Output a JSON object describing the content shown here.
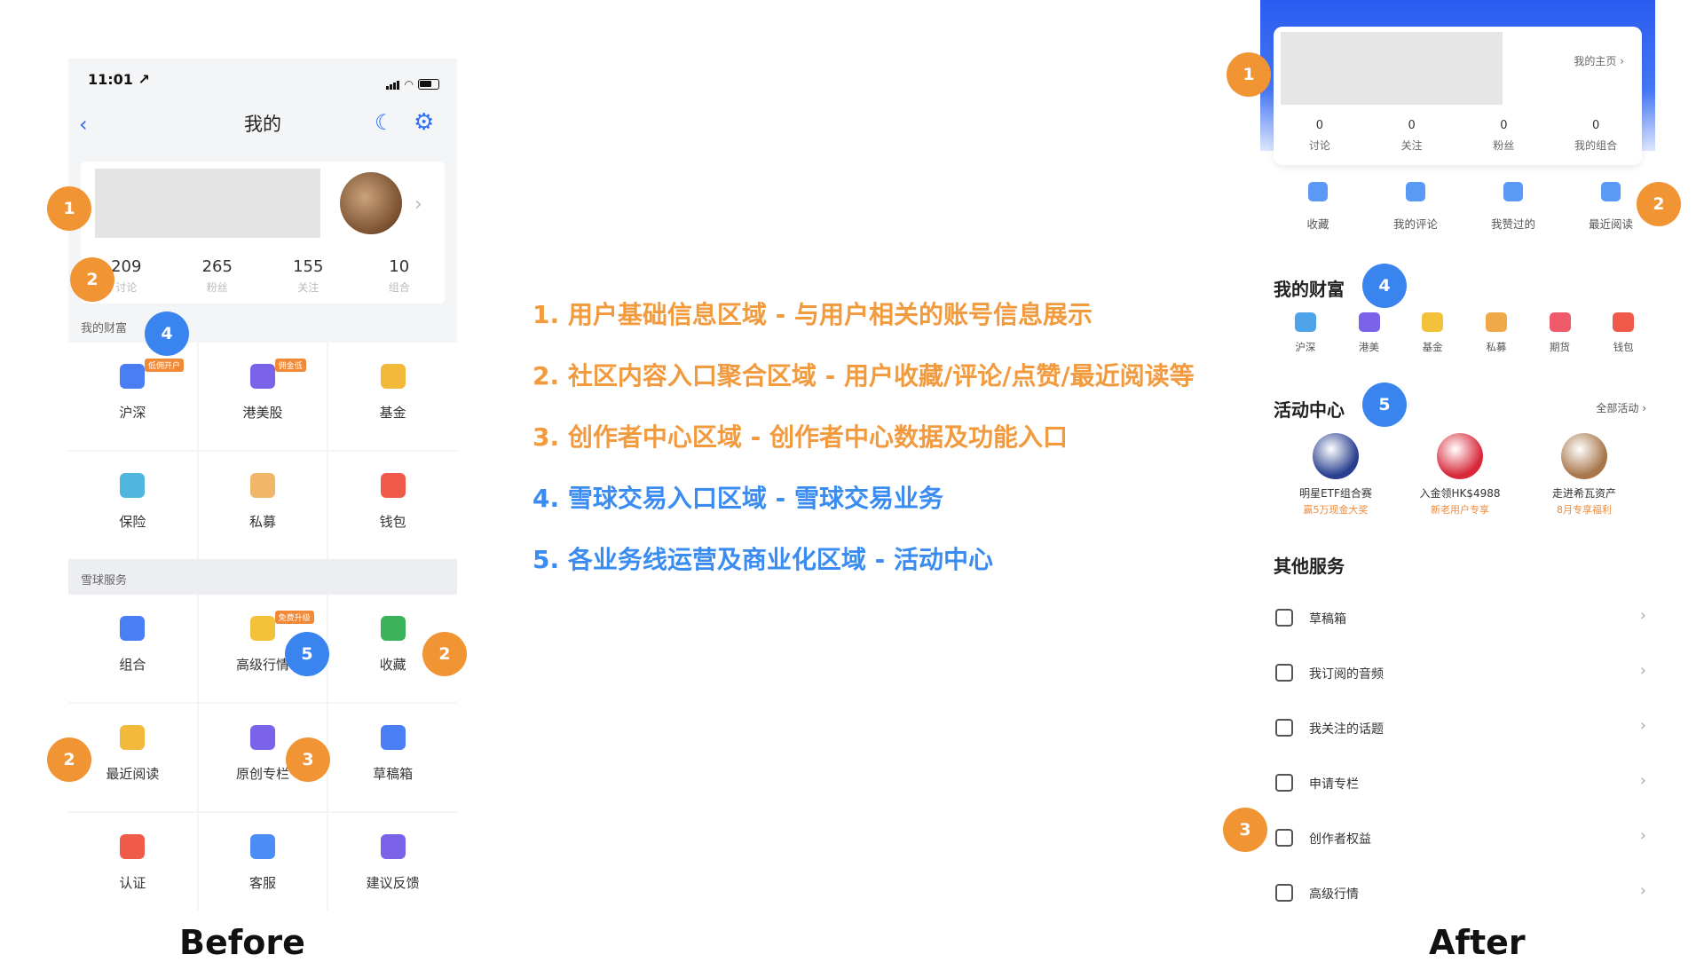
{
  "captions": {
    "before": "Before",
    "after": "After"
  },
  "before": {
    "status_time": "11:01 ↗",
    "title": "我的",
    "stats": [
      {
        "n": "209",
        "l": "讨论"
      },
      {
        "n": "265",
        "l": "粉丝"
      },
      {
        "n": "155",
        "l": "关注"
      },
      {
        "n": "10",
        "l": "组合"
      }
    ],
    "wealth_header": "我的财富",
    "wealth": [
      {
        "l": "沪深",
        "c": "#4a7ef5",
        "b": "低佣开户"
      },
      {
        "l": "港美股",
        "c": "#7a63e8",
        "b": "佣金低"
      },
      {
        "l": "基金",
        "c": "#f3b93a"
      },
      {
        "l": "保险",
        "c": "#4fb6e0"
      },
      {
        "l": "私募",
        "c": "#f0b66a"
      },
      {
        "l": "钱包",
        "c": "#ef5a4a"
      }
    ],
    "service_header": "雪球服务",
    "services": [
      {
        "l": "组合",
        "c": "#4a7ef5"
      },
      {
        "l": "高级行情",
        "c": "#f3c23a",
        "b": "免费升级"
      },
      {
        "l": "收藏",
        "c": "#3cb35a"
      },
      {
        "l": "最近阅读",
        "c": "#f3b93a"
      },
      {
        "l": "原创专栏",
        "c": "#7a63e8"
      },
      {
        "l": "草稿箱",
        "c": "#4a7ef5"
      },
      {
        "l": "认证",
        "c": "#ef5a4a"
      },
      {
        "l": "客服",
        "c": "#4a8ef5"
      },
      {
        "l": "建议反馈",
        "c": "#7a63e8"
      }
    ]
  },
  "middle": {
    "lines": [
      "1.  用户基础信息区域  - 与用户相关的账号信息展示",
      "2.  社区内容入口聚合区域 - 用户收藏/评论/点赞/最近阅读等",
      "3.  创作者中心区域 - 创作者中心数据及功能入口",
      "4.  雪球交易入口区域 - 雪球交易业务",
      "5.  各业务线运营及商业化区域 - 活动中心"
    ]
  },
  "after": {
    "home_link": "我的主页 ›",
    "stats": [
      {
        "n": "0",
        "l": "讨论"
      },
      {
        "n": "0",
        "l": "关注"
      },
      {
        "n": "0",
        "l": "粉丝"
      },
      {
        "n": "0",
        "l": "我的组合"
      }
    ],
    "shortcuts": [
      "收藏",
      "我的评论",
      "我赞过的",
      "最近阅读"
    ],
    "wealth_title": "我的财富",
    "wealth": [
      {
        "l": "沪深",
        "c": "#4fa3e8"
      },
      {
        "l": "港美",
        "c": "#7a63e8"
      },
      {
        "l": "基金",
        "c": "#f3c23a"
      },
      {
        "l": "私募",
        "c": "#f0a848"
      },
      {
        "l": "期货",
        "c": "#ef5a6a"
      },
      {
        "l": "钱包",
        "c": "#ef5a4a"
      }
    ],
    "activity_title": "活动中心",
    "all_activities": "全部活动 ›",
    "activities": [
      {
        "t": "明星ETF组合赛",
        "s": "赢5万现金大奖",
        "c": "#2a3f8f"
      },
      {
        "t": "入金领HK$4988",
        "s": "新老用户专享",
        "c": "#d8283a"
      },
      {
        "t": "走进希瓦资产",
        "s": "8月专享福利",
        "c": "#a8764a"
      }
    ],
    "other_title": "其他服务",
    "services": [
      "草稿箱",
      "我订阅的音频",
      "我关注的话题",
      "申请专栏",
      "创作者权益",
      "高级行情"
    ]
  },
  "markers": {
    "one": "1",
    "two": "2",
    "three": "3",
    "four": "4",
    "five": "5"
  }
}
